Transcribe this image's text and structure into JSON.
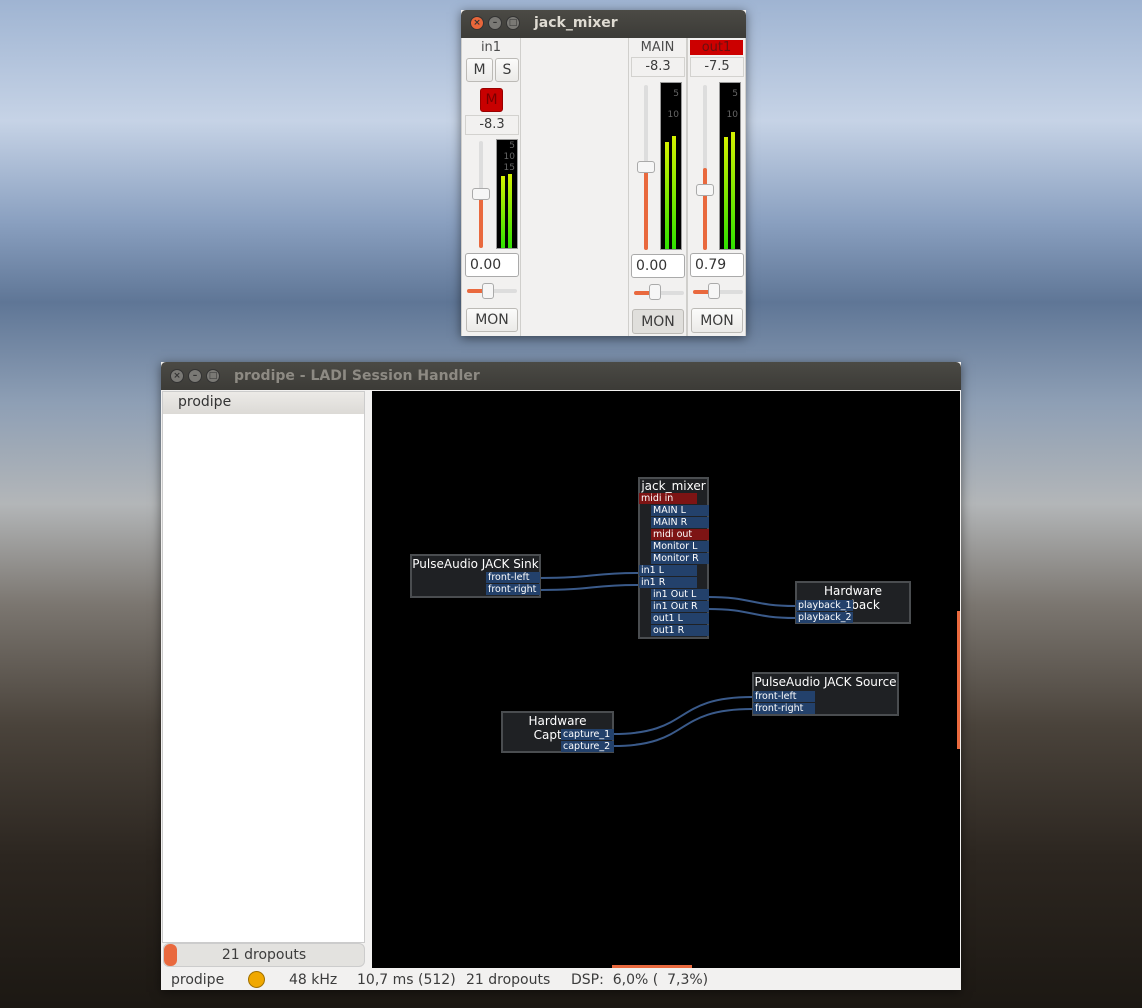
{
  "mixer": {
    "title": "jack_mixer",
    "in1": {
      "name": "in1",
      "mute": "M",
      "solo": "S",
      "midi_mute": "M",
      "peak": "-8.3",
      "gain": "0.00",
      "balance": 0.45,
      "fader": 0.65,
      "mon": "MON",
      "meters": [
        0.66,
        0.68
      ]
    },
    "main": {
      "name": "MAIN",
      "peak": "-8.3",
      "gain": "0.00",
      "balance": 0.45,
      "fader": 0.55,
      "mon": "MON",
      "meters": [
        0.68,
        0.7
      ]
    },
    "out1": {
      "name": "out1",
      "peak": "-7.5",
      "gain": "0.79",
      "balance": 0.45,
      "fader": 0.55,
      "mon": "MON",
      "meters": [
        0.7,
        0.72
      ],
      "highlight": "#cc0000"
    },
    "meter_ticks": [
      "5",
      "10",
      "15"
    ]
  },
  "ladish": {
    "title": "prodipe - LADI Session Handler",
    "sidebar": {
      "header": "prodipe",
      "xruns": "21 dropouts"
    },
    "nodes": {
      "jack_mixer": {
        "title": "jack_mixer",
        "ports": [
          "midi in",
          "MAIN L",
          "MAIN R",
          "midi out",
          "Monitor L",
          "Monitor R",
          "in1 L",
          "in1 R",
          "in1 Out L",
          "in1 Out R",
          "out1 L",
          "out1 R"
        ]
      },
      "sink": {
        "title": "PulseAudio JACK Sink",
        "ports": [
          "front-left",
          "front-right"
        ]
      },
      "playback": {
        "title": "Hardware Playback",
        "ports": [
          "playback_1",
          "playback_2"
        ]
      },
      "source": {
        "title": "PulseAudio JACK Source",
        "ports": [
          "front-left",
          "front-right"
        ]
      },
      "capture": {
        "title": "Hardware Capture",
        "ports": [
          "capture_1",
          "capture_2"
        ]
      }
    },
    "status": {
      "session": "prodipe",
      "rate": "48 kHz",
      "latency": "10,7 ms (512)",
      "dropouts": "21 dropouts",
      "dsp": "DSP:  6,0% (  7,3%)",
      "indicator_color": "#f0a800"
    }
  },
  "colors": {
    "audio_port": "#23416b",
    "midi_port": "#7d1414",
    "wire": "#3a5a8a",
    "accent": "#e9693e"
  }
}
